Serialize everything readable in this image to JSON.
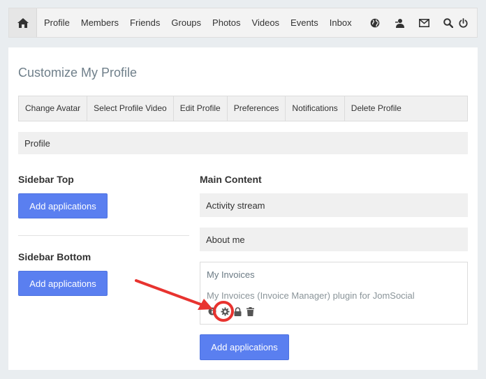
{
  "nav": {
    "items": [
      "Profile",
      "Members",
      "Friends",
      "Groups",
      "Photos",
      "Videos",
      "Events",
      "Inbox"
    ],
    "icons": [
      "home-icon",
      "globe-icon",
      "user-icon",
      "mail-icon",
      "search-icon",
      "power-icon"
    ]
  },
  "page": {
    "title": "Customize My Profile"
  },
  "tabs": [
    "Change Avatar",
    "Select Profile Video",
    "Edit Profile",
    "Preferences",
    "Notifications",
    "Delete Profile"
  ],
  "profile_bar": "Profile",
  "sidebar_top": {
    "title": "Sidebar Top",
    "button": "Add applications"
  },
  "sidebar_bottom": {
    "title": "Sidebar Bottom",
    "button": "Add applications"
  },
  "main_content": {
    "title": "Main Content",
    "apps": [
      "Activity stream",
      "About me"
    ],
    "expanded_app": {
      "title": "My Invoices",
      "description": "My Invoices (Invoice Manager) plugin for JomSocial",
      "actions": [
        "info-icon",
        "gear-icon",
        "lock-icon",
        "trash-icon"
      ]
    },
    "button": "Add applications"
  },
  "annotation": {
    "color": "#e8332f"
  }
}
